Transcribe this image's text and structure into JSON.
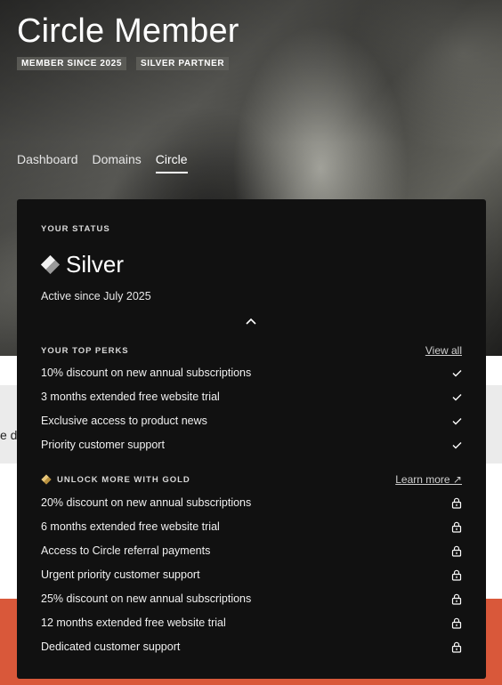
{
  "header": {
    "title": "Circle Member",
    "badges": [
      "MEMBER SINCE 2025",
      "SILVER PARTNER"
    ]
  },
  "tabs": [
    {
      "label": "Dashboard",
      "active": false
    },
    {
      "label": "Domains",
      "active": false
    },
    {
      "label": "Circle",
      "active": true
    }
  ],
  "background": {
    "partial_text": "e di"
  },
  "status_card": {
    "label": "YOUR STATUS",
    "tier": "Silver",
    "active_since": "Active since July 2025",
    "collapse_icon": "chevron-up-icon"
  },
  "top_perks": {
    "label": "YOUR TOP PERKS",
    "link": "View all",
    "items": [
      "10% discount on new annual subscriptions",
      "3 months extended free website trial",
      "Exclusive access to product news",
      "Priority customer support"
    ],
    "item_icon": "check-icon"
  },
  "gold": {
    "label": "UNLOCK MORE WITH GOLD",
    "link": "Learn more ↗",
    "items": [
      "20% discount on new annual subscriptions",
      "6 months extended free website trial",
      "Access to Circle referral payments",
      "Urgent priority customer support",
      "25% discount on new annual subscriptions",
      "12 months extended free website trial",
      "Dedicated customer support"
    ],
    "item_icon": "lock-icon"
  },
  "colors": {
    "card_bg": "#111111",
    "accent_orange": "#d9583a",
    "gold": "#e8c77a"
  }
}
